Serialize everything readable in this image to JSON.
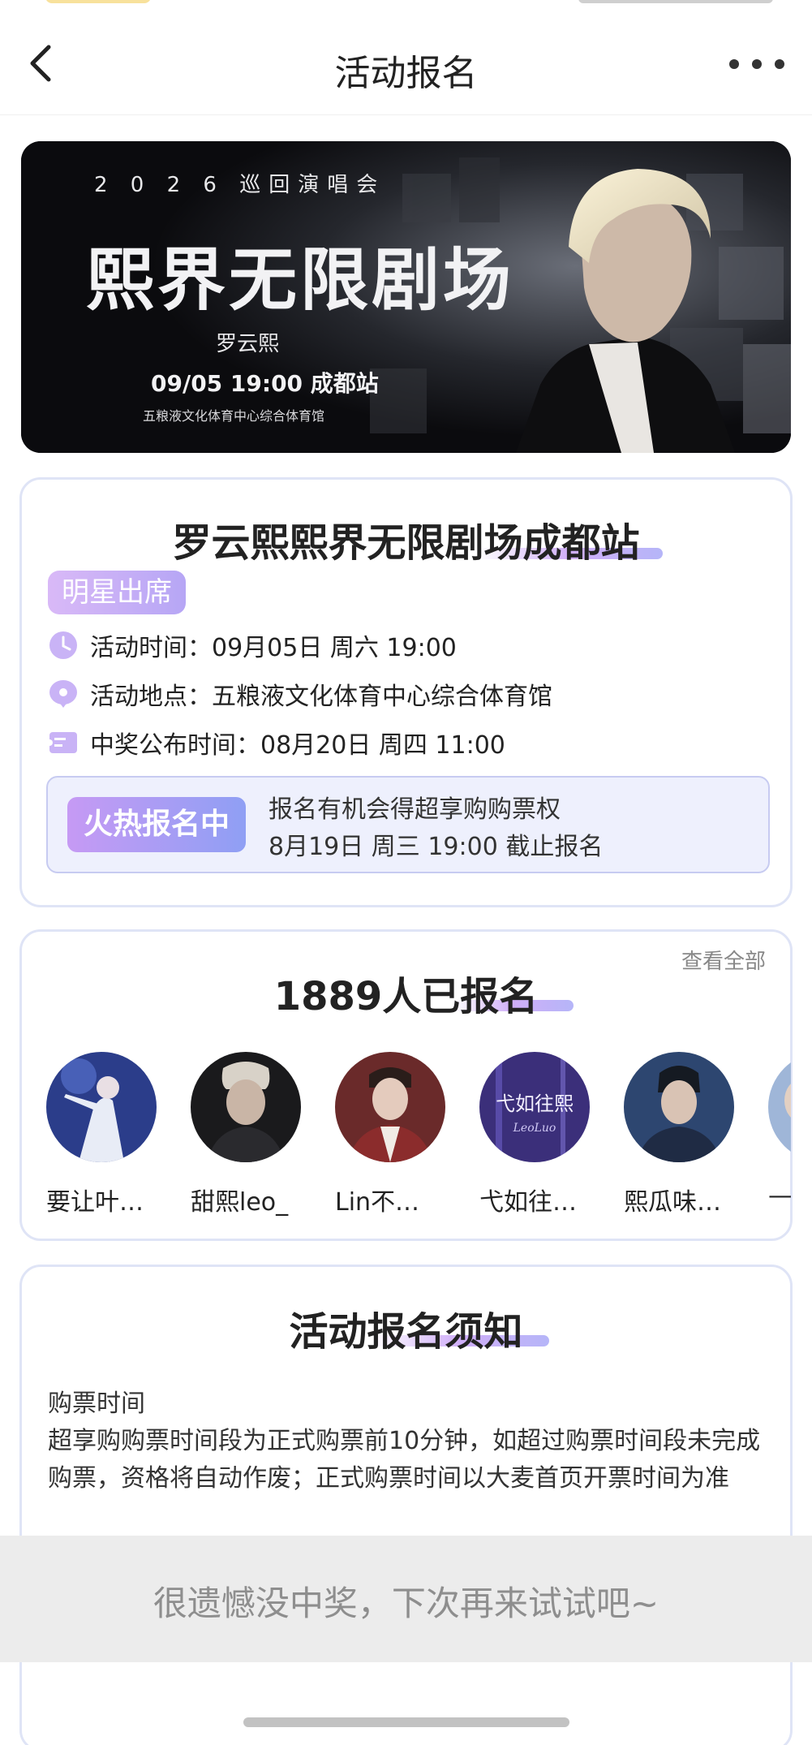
{
  "nav": {
    "title": "活动报名",
    "back_icon": "chevron-left-icon",
    "more_icon": "more-dots-icon"
  },
  "banner": {
    "tour_line": "2 0 2 6 巡回演唱会",
    "title_art": "熙界无限剧场",
    "signature": "罗云熙",
    "date_line": "09/05  19:00  成都站",
    "venue_line": "五粮液文化体育中心综合体育馆"
  },
  "event": {
    "title": "罗云熙熙界无限剧场成都站",
    "tag": "明星出席",
    "time_label": "活动时间：",
    "time_value": "09月05日 周六 19:00",
    "place_label": "活动地点：",
    "place_value": "五粮液文化体育中心综合体育馆",
    "announce_label": "中奖公布时间：",
    "announce_value": "08月20日 周四 11:00",
    "status_badge": "火热报名中",
    "status_line1": "报名有机会得超享购购票权",
    "status_line2": "8月19日 周三 19:00 截止报名"
  },
  "registration": {
    "view_all": "查看全部",
    "count_title": "1889人已报名",
    "users": [
      {
        "name": "要让叶…"
      },
      {
        "name": "甜熙leo_"
      },
      {
        "name": "Lin不…"
      },
      {
        "name": "弋如往…",
        "avatar_text": "弋如往熙",
        "avatar_sub": "LeoLuo"
      },
      {
        "name": "熙瓜味…"
      },
      {
        "name": "—"
      }
    ]
  },
  "notice": {
    "title": "活动报名须知",
    "heading": "购票时间",
    "body": "超享购购票时间段为正式购票前10分钟，如超过购票时间段未完成购票，资格将自动作废；正式购票时间以大麦首页开票时间为准"
  },
  "bottom": {
    "message": "很遗憾没中奖，下次再来试试吧~"
  },
  "colors": {
    "accent_purple": "#b89ef5",
    "card_border": "#dfe4f6",
    "hot_bg": "#eef0fd"
  }
}
